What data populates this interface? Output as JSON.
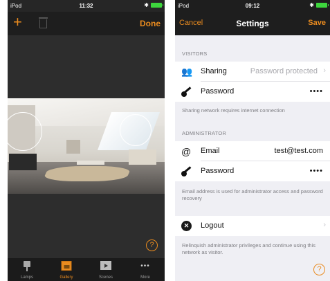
{
  "left_screen": {
    "status": {
      "carrier": "iPod",
      "time": "11:32",
      "bluetooth": "✱"
    },
    "nav": {
      "add_icon": "plus-icon",
      "delete_icon": "trash-icon",
      "done_label": "Done"
    },
    "help_label": "?",
    "tabs": [
      {
        "label": "Lamps",
        "icon": "lamp-icon",
        "active": false
      },
      {
        "label": "Gallery",
        "icon": "gallery-icon",
        "active": true
      },
      {
        "label": "Scenes",
        "icon": "scenes-icon",
        "active": false
      },
      {
        "label": "More",
        "icon": "more-icon",
        "active": false
      }
    ],
    "more_glyph": "•••"
  },
  "right_screen": {
    "status": {
      "carrier": "iPod",
      "time": "09:12",
      "bluetooth": "✱"
    },
    "nav": {
      "cancel_label": "Cancel",
      "title": "Settings",
      "save_label": "Save"
    },
    "visitors": {
      "header": "VISITORS",
      "sharing": {
        "label": "Sharing",
        "value": "Password protected",
        "icon": "visitors-icon"
      },
      "password": {
        "label": "Password",
        "value": "••••",
        "icon": "key-icon"
      },
      "note": "Sharing network requires internet connection"
    },
    "administrator": {
      "header": "ADMINISTRATOR",
      "email": {
        "label": "Email",
        "value": "test@test.com",
        "icon": "at-icon"
      },
      "password": {
        "label": "Password",
        "value": "••••",
        "icon": "key-icon"
      },
      "note": "Email address is used for administrator access and password recovery"
    },
    "logout": {
      "label": "Logout",
      "icon": "logout-icon",
      "note": "Relinquish administrator privileges and continue using this network as visitor."
    },
    "help_label": "?"
  },
  "colors": {
    "accent": "#e98b1f",
    "dark_bar": "#1e1e1e",
    "grouped_bg": "#efeff4"
  }
}
